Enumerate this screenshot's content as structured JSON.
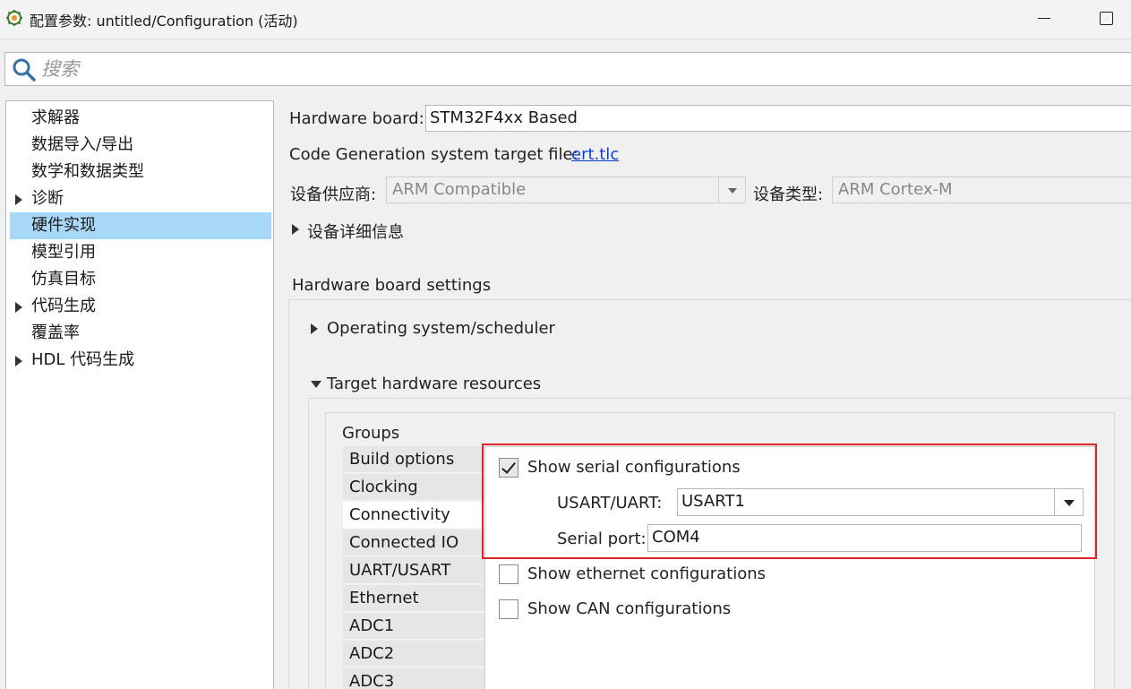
{
  "window": {
    "title": "配置参数: untitled/Configuration (活动)",
    "app_icon": "gear-cube-icon"
  },
  "search": {
    "placeholder": "搜索",
    "value": ""
  },
  "sidebar": {
    "items": [
      {
        "label": "求解器",
        "expandable": false,
        "selected": false
      },
      {
        "label": "数据导入/导出",
        "expandable": false,
        "selected": false
      },
      {
        "label": "数学和数据类型",
        "expandable": false,
        "selected": false
      },
      {
        "label": "诊断",
        "expandable": true,
        "selected": false
      },
      {
        "label": "硬件实现",
        "expandable": false,
        "selected": true
      },
      {
        "label": "模型引用",
        "expandable": false,
        "selected": false
      },
      {
        "label": "仿真目标",
        "expandable": false,
        "selected": false
      },
      {
        "label": "代码生成",
        "expandable": true,
        "selected": false
      },
      {
        "label": "覆盖率",
        "expandable": false,
        "selected": false
      },
      {
        "label": "HDL 代码生成",
        "expandable": true,
        "selected": false
      }
    ]
  },
  "main": {
    "hardware_board_label": "Hardware board:",
    "hardware_board_value": "STM32F4xx Based",
    "codegen_label": "Code Generation system target file:",
    "codegen_link": "ert.tlc",
    "vendor_label": "设备供应商:",
    "vendor_value": "ARM Compatible",
    "device_type_label": "设备类型:",
    "device_type_value": "ARM Cortex-M",
    "device_details_label": "设备详细信息",
    "board_settings_title": "Hardware board settings",
    "os_scheduler_label": "Operating system/scheduler",
    "target_resources_label": "Target hardware resources",
    "groups_label": "Groups",
    "groups": [
      {
        "label": "Build options",
        "active": false
      },
      {
        "label": "Clocking",
        "active": false
      },
      {
        "label": "Connectivity",
        "active": true
      },
      {
        "label": "Connected IO",
        "active": false
      },
      {
        "label": "UART/USART",
        "active": false
      },
      {
        "label": "Ethernet",
        "active": false
      },
      {
        "label": "ADC1",
        "active": false
      },
      {
        "label": "ADC2",
        "active": false
      },
      {
        "label": "ADC3",
        "active": false
      }
    ],
    "connectivity": {
      "show_serial_label": "Show serial configurations",
      "show_serial_checked": true,
      "usart_label": "USART/UART:",
      "usart_value": "USART1",
      "serial_port_label": "Serial port:",
      "serial_port_value": "COM4",
      "show_ethernet_label": "Show ethernet configurations",
      "show_ethernet_checked": false,
      "show_can_label": "Show CAN configurations",
      "show_can_checked": false
    }
  },
  "colors": {
    "selection": "#a8d8f8",
    "highlight_border": "#e0242b",
    "link": "#0b3fd3"
  }
}
